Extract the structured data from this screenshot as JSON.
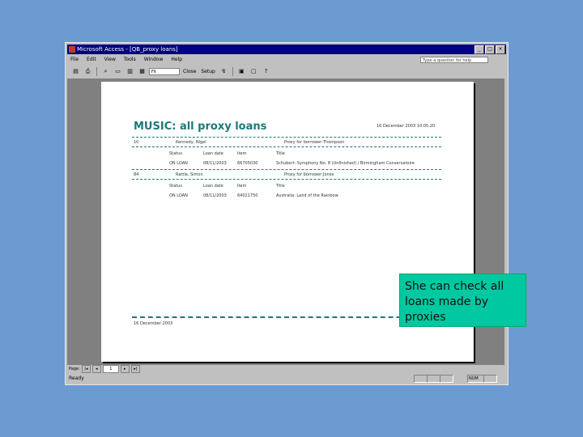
{
  "window": {
    "title": "Microsoft Access - [QB_proxy loans]",
    "controls": [
      "_",
      "□",
      "×"
    ]
  },
  "menu": [
    "File",
    "Edit",
    "View",
    "Tools",
    "Window",
    "Help"
  ],
  "help_box": {
    "placeholder": "Type a question for help"
  },
  "toolbar": {
    "zoom_value": "Fit",
    "close_label": "Close",
    "setup_label": "Setup"
  },
  "report": {
    "title": "MUSIC: all proxy loans",
    "printed": "16 December 2003 10:05:20",
    "groups": [
      {
        "id": "10",
        "name": "Kennedy, Nigel",
        "label_text": "Proxy for borrower:",
        "proxy": "Thompson",
        "headers": [
          "Status",
          "Loan date",
          "Item",
          "Title"
        ],
        "row": [
          "ON LOAN",
          "08/11/2003",
          "66705030",
          "Schubert: Symphony No. 8 (Unfinished) / Birmingham Conservatoire"
        ]
      },
      {
        "id": "84",
        "name": "Rattle, Simon",
        "label_text": "Proxy for borrower:",
        "proxy": "Jones",
        "headers": [
          "Status",
          "Loan date",
          "Item",
          "Title"
        ],
        "row": [
          "ON LOAN",
          "08/11/2003",
          "64021750",
          "Australia: Land of the Rainbow"
        ]
      }
    ],
    "footer": "16 December 2003"
  },
  "status": {
    "page_label": "Page:",
    "page_value": "1",
    "ready": "Ready",
    "num": "NUM"
  },
  "note": "She can check all loans made by proxies"
}
